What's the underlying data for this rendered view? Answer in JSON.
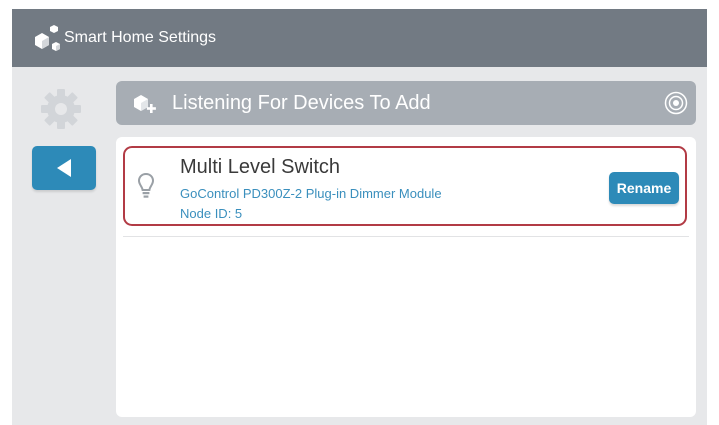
{
  "header": {
    "title": "Smart Home Settings",
    "icon": "smart-home-cubes-icon"
  },
  "sidebar": {
    "settings_icon": "gear-icon",
    "back_icon": "back-arrow-icon"
  },
  "listening_bar": {
    "label": "Listening For Devices To Add",
    "icon": "add-device-icon",
    "status_icon": "listening-ring-icon"
  },
  "devices": [
    {
      "name": "Multi Level Switch",
      "model": "GoControl PD300Z-2 Plug-in Dimmer Module",
      "node": "Node ID: 5",
      "icon": "lightbulb-icon",
      "rename_label": "Rename",
      "selected": true
    }
  ],
  "colors": {
    "header_bg": "#727a83",
    "accent_blue": "#2d8ab8",
    "link_blue": "#3a8fbd",
    "selection_border": "#b23b45",
    "listening_bar_bg": "#a7adb4",
    "background": "#e7e8ea"
  }
}
